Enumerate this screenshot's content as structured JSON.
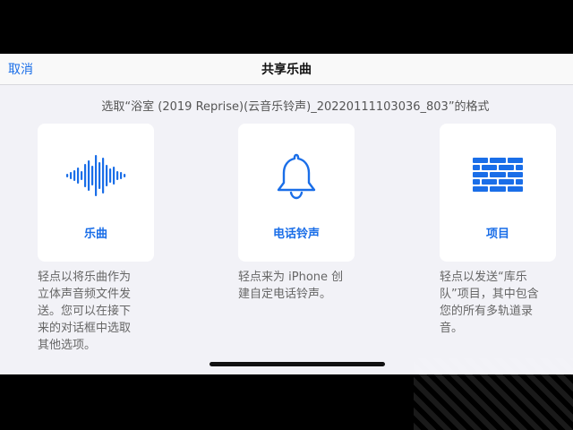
{
  "navbar": {
    "cancel_label": "取消",
    "title": "共享乐曲"
  },
  "subtitle": "选取“浴室 (2019 Reprise)(云音乐铃声)_20220111103036_803”的格式",
  "options": [
    {
      "icon": "waveform-icon",
      "label": "乐曲",
      "description": [
        "轻点以将乐曲作为",
        "立体声音频文件发",
        "送。您可以在接下",
        "来的对话框中选取",
        "其他选项。"
      ]
    },
    {
      "icon": "bell-icon",
      "label": "电话铃声",
      "description": [
        "轻点来为 iPhone 创",
        "建自定电话铃声。"
      ]
    },
    {
      "icon": "brick-wall-icon",
      "label": "项目",
      "description": [
        "轻点以发送“库乐",
        "队”项目，其中包含",
        "您的所有多轨道录",
        "音。"
      ]
    }
  ],
  "colors": {
    "accent": "#1a6ee8",
    "background": "#f2f2f7",
    "card": "#ffffff"
  }
}
